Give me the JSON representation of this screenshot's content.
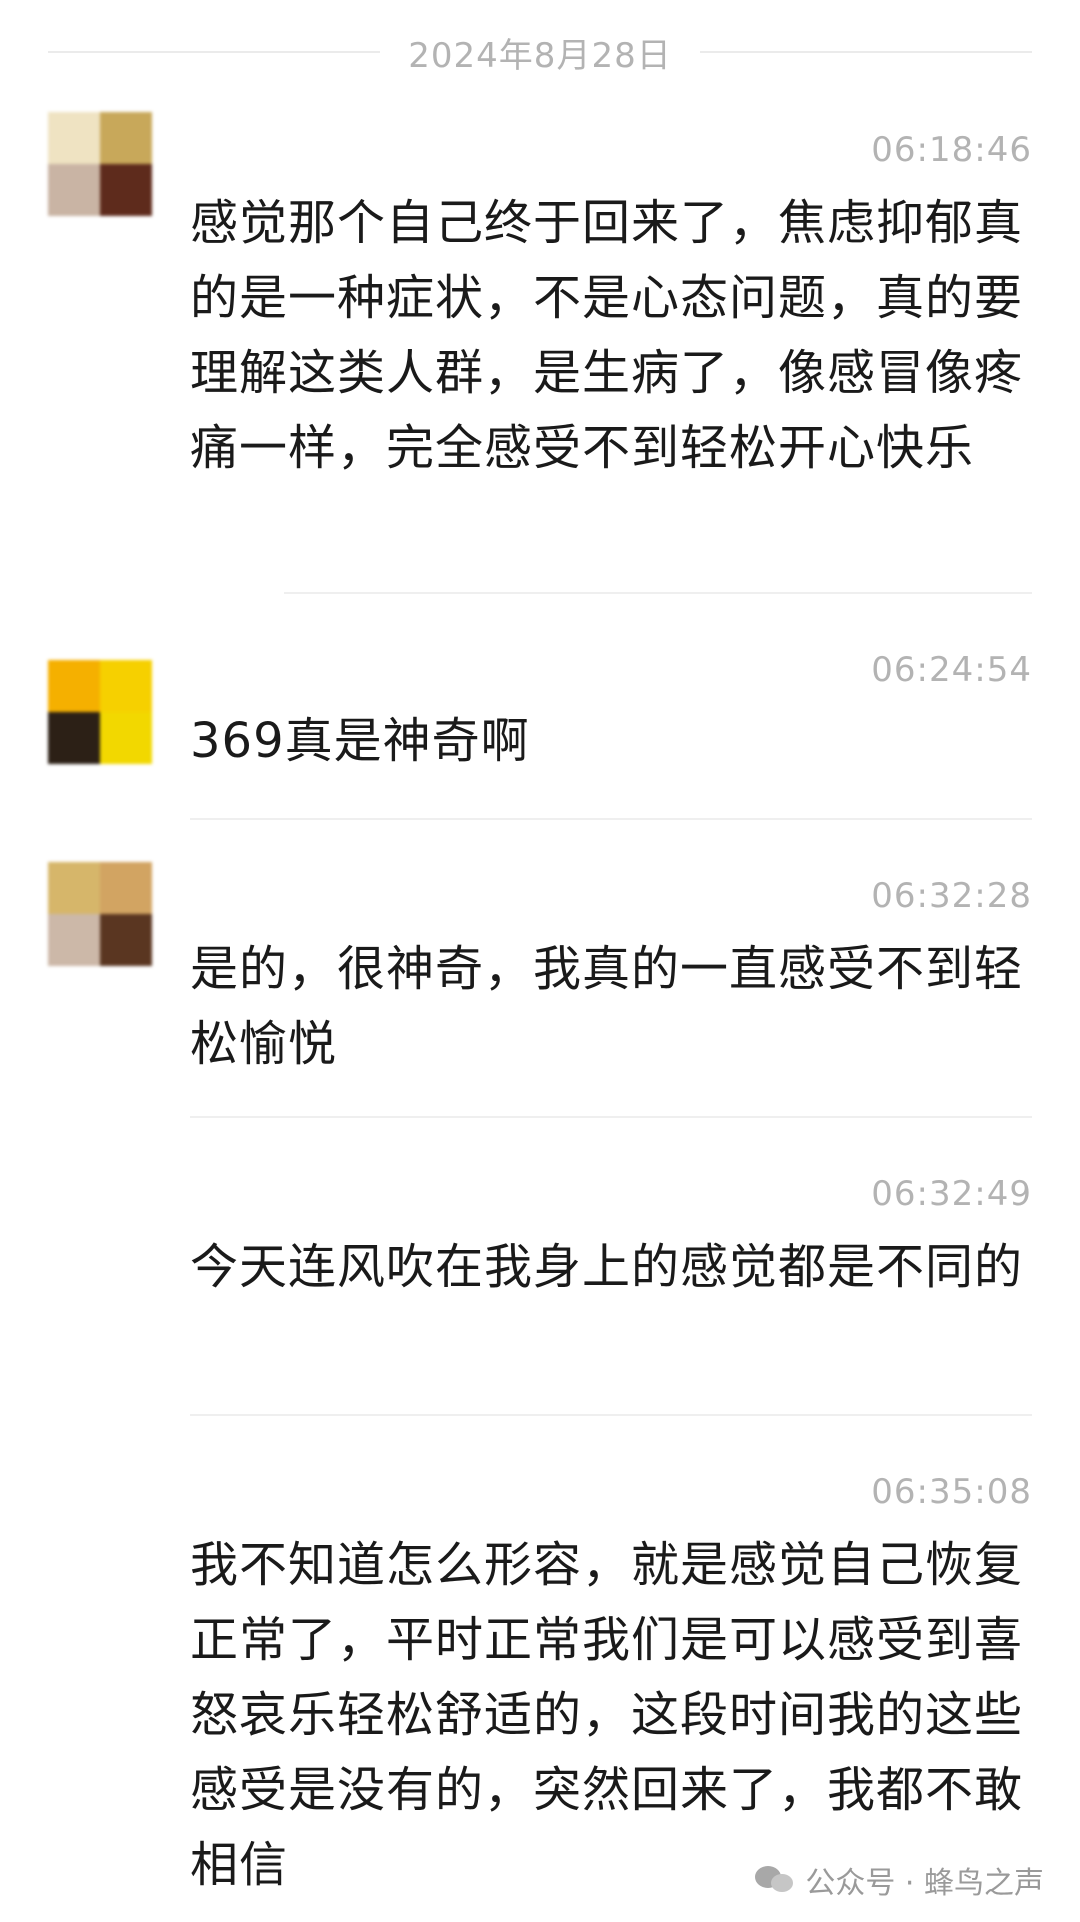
{
  "date_separator": "2024年8月28日",
  "messages": [
    {
      "time": "06:18:46",
      "text": "感觉那个自己终于回来了，焦虑抑郁真的是一种症状，不是心态问题，真的要理解这类人群，是生病了，像感冒像疼痛一样，完全感受不到轻松开心快乐",
      "avatar_colors": [
        "#efe3c2",
        "#c8a85a",
        "#c9b4a4",
        "#5e2b1c"
      ]
    },
    {
      "time": "06:24:54",
      "text": "369真是神奇啊",
      "avatar_colors": [
        "#f5b000",
        "#f6d000",
        "#2c2016",
        "#f2d800"
      ]
    },
    {
      "time": "06:32:28",
      "text": "是的，很神奇，我真的一直感受不到轻松愉悦",
      "avatar_colors": [
        "#d6b66a",
        "#d2a462",
        "#ccb8a8",
        "#5a3621"
      ]
    },
    {
      "time": "06:32:49",
      "text": "今天连风吹在我身上的感觉都是不同的"
    },
    {
      "time": "06:35:08",
      "text": "我不知道怎么形容，就是感觉自己恢复正常了，平时正常我们是可以感受到喜怒哀乐轻松舒适的，这段时间我的这些感受是没有的，突然回来了，我都不敢相信"
    }
  ],
  "watermark": {
    "icon": "wechat-icon",
    "text": "公众号 · 蜂鸟之声"
  }
}
